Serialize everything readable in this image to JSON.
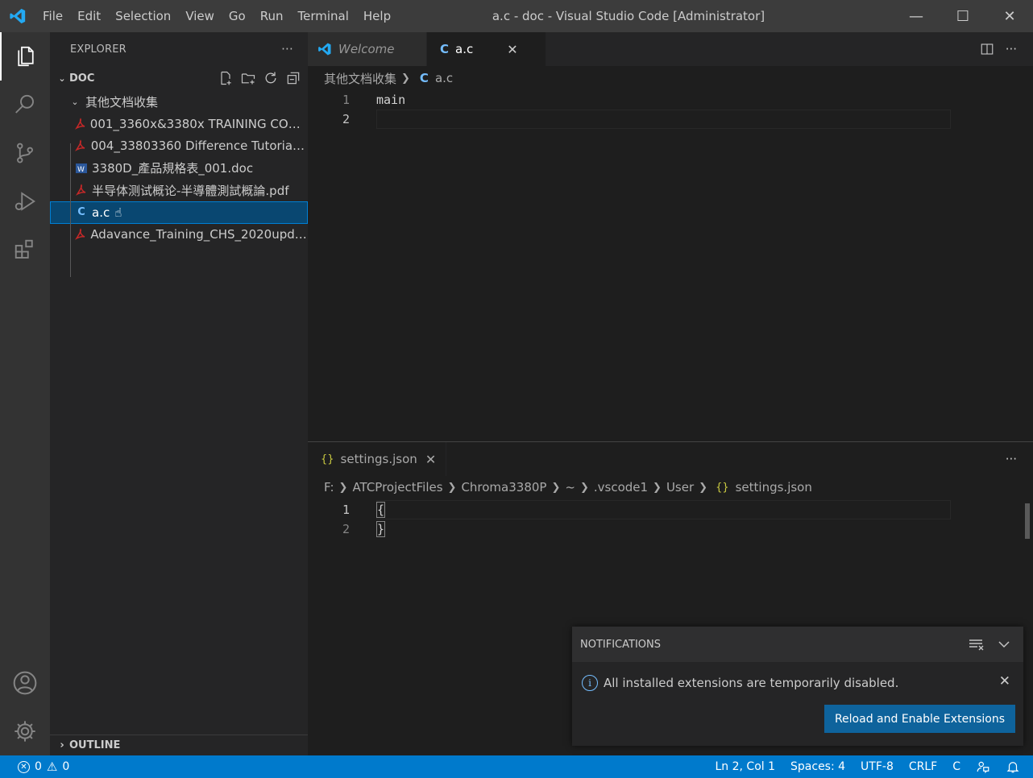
{
  "window": {
    "title": "a.c - doc - Visual Studio Code [Administrator]",
    "minimize": "—",
    "maximize": "☐",
    "close": "✕"
  },
  "menu": [
    "File",
    "Edit",
    "Selection",
    "View",
    "Go",
    "Run",
    "Terminal",
    "Help"
  ],
  "sidebar": {
    "title": "EXPLORER",
    "more": "···",
    "root": "DOC",
    "folder": "其他文档收集",
    "files": [
      {
        "label": "001_3360x&3380x TRAINING COURSE...",
        "icon": "pdf-icon"
      },
      {
        "label": "004_33803360 Difference Tutorial_2...",
        "icon": "pdf-icon"
      },
      {
        "label": "3380D_產品規格表_001.doc",
        "icon": "word-icon"
      },
      {
        "label": "半导体测试概论-半導體測試概論.pdf",
        "icon": "pdf-icon"
      },
      {
        "label": "a.c",
        "icon": "c-file-icon"
      },
      {
        "label": "Adavance_Training_CHS_2020update...",
        "icon": "pdf-icon"
      }
    ],
    "outline": "OUTLINE"
  },
  "editor1": {
    "tabs": [
      {
        "label": "Welcome",
        "icon": "vscode-icon"
      },
      {
        "label": "a.c",
        "icon": "c-file-icon",
        "close": "✕"
      }
    ],
    "breadcrumb": [
      "其他文档收集",
      "a.c"
    ],
    "lines": [
      {
        "num": "1",
        "text": "main"
      },
      {
        "num": "2",
        "text": ""
      }
    ],
    "more": "···"
  },
  "editor2": {
    "tab": {
      "label": "settings.json",
      "close": "✕",
      "icon": "json-icon"
    },
    "breadcrumb": [
      "F:",
      "ATCProjectFiles",
      "Chroma3380P",
      "~",
      ".vscode1",
      "User",
      "settings.json"
    ],
    "lines": [
      {
        "num": "1",
        "text": "{"
      },
      {
        "num": "2",
        "text": "}"
      }
    ],
    "more": "···"
  },
  "notifications": {
    "header": "NOTIFICATIONS",
    "message": "All installed extensions are temporarily disabled.",
    "button": "Reload and Enable Extensions",
    "close": "✕"
  },
  "statusbar": {
    "errors": "0",
    "warnings": "0",
    "position": "Ln 2, Col 1",
    "spaces": "Spaces: 4",
    "encoding": "UTF-8",
    "eol": "CRLF",
    "language": "C"
  },
  "colors": {
    "accent": "#007acc",
    "selection": "#094771",
    "button": "#0e639c",
    "pdf": "#c62828",
    "c_icon": "#75beff"
  }
}
